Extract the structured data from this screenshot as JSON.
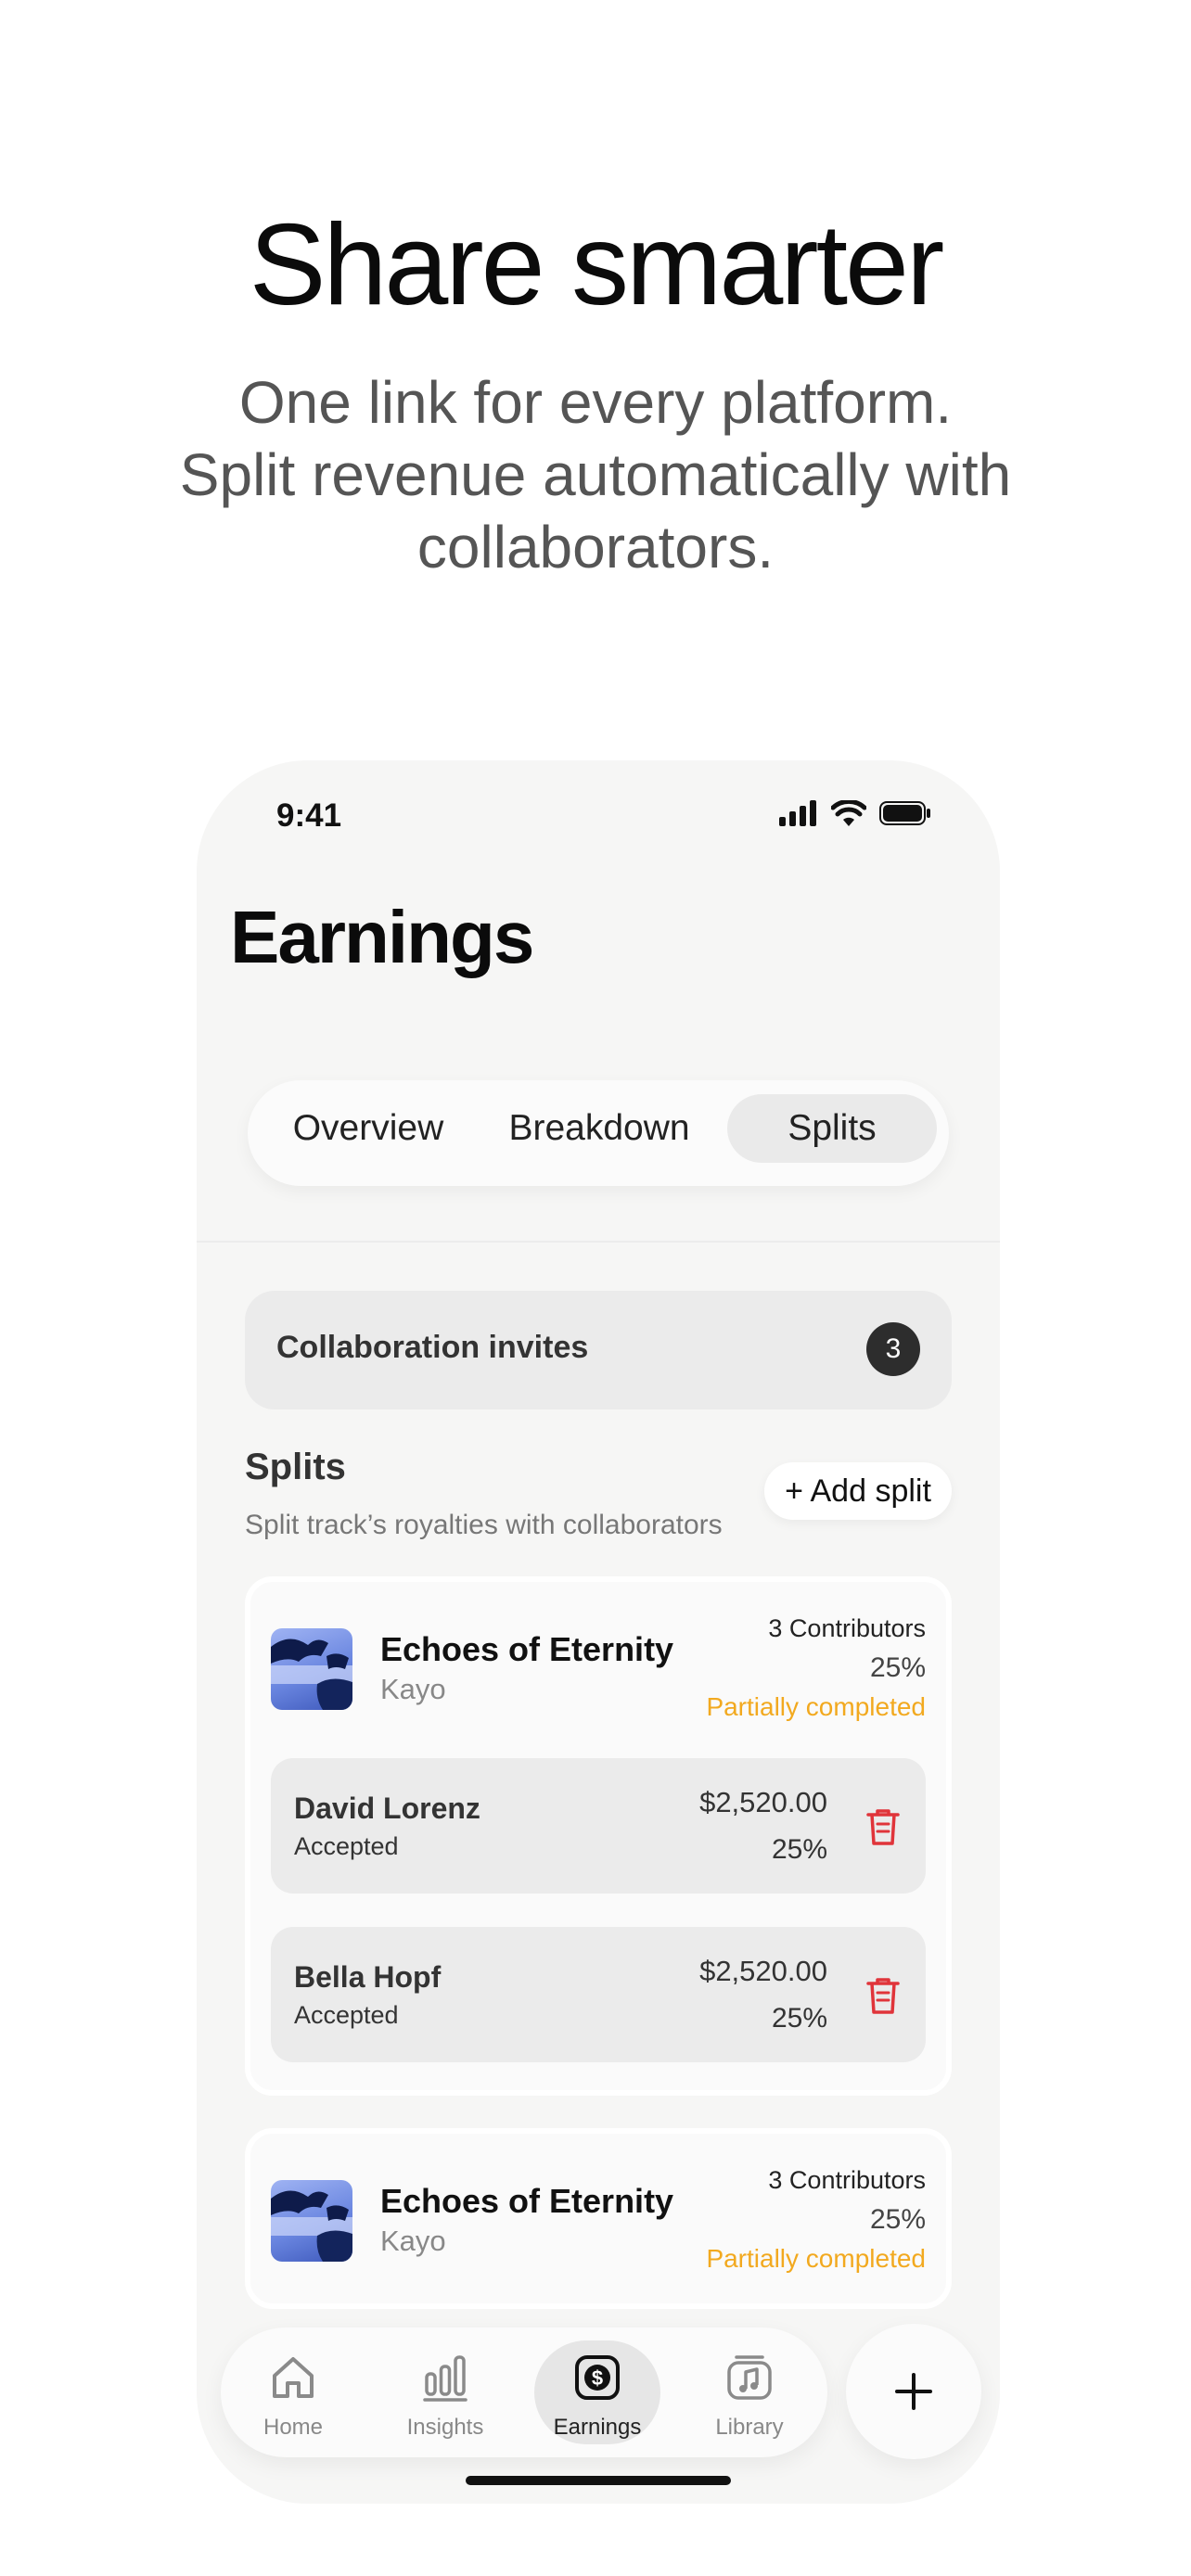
{
  "hero": {
    "title": "Share smarter",
    "subtitle_line1": "One link for every platform.",
    "subtitle_line2": "Split revenue automatically with",
    "subtitle_line3": "collaborators."
  },
  "status_bar": {
    "time": "9:41"
  },
  "page": {
    "title": "Earnings"
  },
  "segments": [
    "Overview",
    "Breakdown",
    "Splits"
  ],
  "selected_segment": "Splits",
  "invites": {
    "label": "Collaboration invites",
    "count": "3"
  },
  "splits": {
    "title": "Splits",
    "subtitle": "Split track’s royalties with collaborators",
    "add_label": "+ Add split"
  },
  "cards": [
    {
      "title": "Echoes of Eternity",
      "artist": "Kayo",
      "contributors": "3 Contributors",
      "percent": "25%",
      "status": "Partially completed",
      "rows": [
        {
          "name": "David Lorenz",
          "status": "Accepted",
          "amount": "$2,520.00",
          "percent": "25%"
        },
        {
          "name": "Bella Hopf",
          "status": "Accepted",
          "amount": "$2,520.00",
          "percent": "25%"
        }
      ]
    },
    {
      "title": "Echoes of Eternity",
      "artist": "Kayo",
      "contributors": "3 Contributors",
      "percent": "25%",
      "status": "Partially completed"
    }
  ],
  "tabbar": {
    "home": "Home",
    "insights": "Insights",
    "earnings": "Earnings",
    "library": "Library",
    "active": "Earnings"
  },
  "icons": {
    "signal": "cellular-signal-icon",
    "wifi": "wifi-icon",
    "battery": "battery-icon",
    "trash": "trash-icon",
    "home": "home-icon",
    "insights": "bar-chart-icon",
    "earnings": "dollar-icon",
    "library": "music-library-icon",
    "plus": "plus-icon"
  },
  "colors": {
    "partial_status": "#f2a91f",
    "delete_red": "#e0343a",
    "badge": "#2d2d2d",
    "phone_bg": "#f6f6f5"
  }
}
